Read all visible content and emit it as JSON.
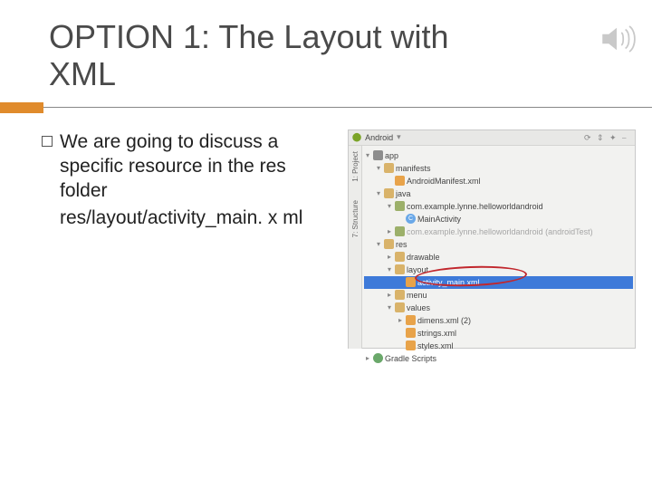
{
  "title_line1": "OPTION 1: The Layout with",
  "title_line2": "XML",
  "bullet_text": "We are going to discuss a specific resource in the res folder",
  "path_text": "res/layout/activity_main. x ml",
  "ide": {
    "project_label": "Android",
    "side_tab_1": "1: Project",
    "side_tab_2": "7: Structure",
    "tree": {
      "app": "app",
      "manifests": "manifests",
      "android_manifest": "AndroidManifest.xml",
      "java": "java",
      "pkg1": "com.example.lynne.helloworldandroid",
      "main_activity": "MainActivity",
      "pkg2": "com.example.lynne.helloworldandroid (androidTest)",
      "res": "res",
      "drawable": "drawable",
      "layout": "layout",
      "activity_main": "activity_main.xml",
      "menu": "menu",
      "values": "values",
      "dimens": "dimens.xml (2)",
      "strings": "strings.xml",
      "styles": "styles.xml",
      "gradle": "Gradle Scripts"
    }
  }
}
